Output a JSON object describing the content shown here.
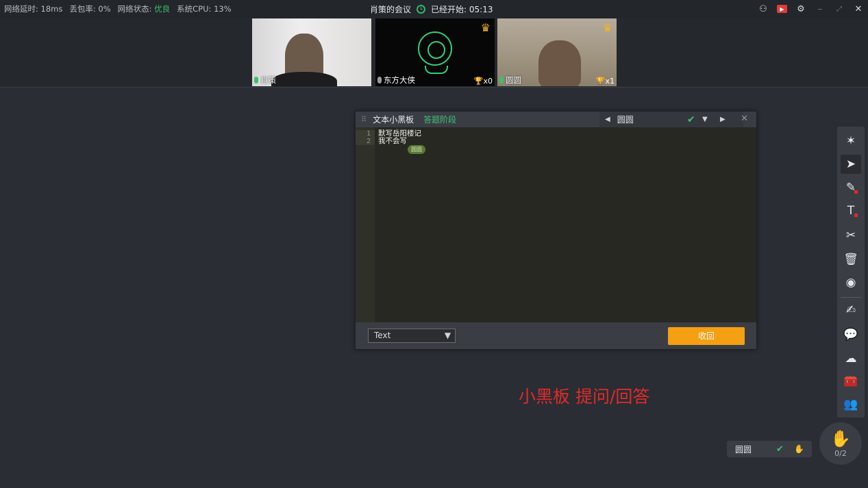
{
  "topbar": {
    "latency_label": "网络延时:",
    "latency_value": "18ms",
    "loss_label": "丢包率:",
    "loss_value": "0%",
    "net_label": "网络状态:",
    "net_value": "优良",
    "cpu_label": "系统CPU:",
    "cpu_value": "13%",
    "meeting_title": "肖策的会议",
    "started_label": "已经开始:",
    "elapsed": "05:13"
  },
  "participants": [
    {
      "name": "肖策",
      "mic": "on",
      "crown": false
    },
    {
      "name": "东方大侠",
      "mic": "off",
      "crown": true,
      "trophy": "x0"
    },
    {
      "name": "圆圆",
      "mic": "on",
      "crown": true,
      "trophy": "x1"
    }
  ],
  "panel": {
    "title": "文本小黑板",
    "stage": "答题阶段",
    "selected_user": "圆圆",
    "lines": [
      {
        "num": "1",
        "text": "默写岳阳楼记"
      },
      {
        "num": "2",
        "text": "我不会写"
      }
    ],
    "cursor_label": "圆圆",
    "language": "Text",
    "retract_label": "收回"
  },
  "caption": "小黑板 提问/回答",
  "raise": {
    "user": "圆圆",
    "count": "0/2"
  },
  "colors": {
    "accent_green": "#3fc276",
    "accent_orange": "#f59f12",
    "caption_red": "#e02b2b"
  }
}
